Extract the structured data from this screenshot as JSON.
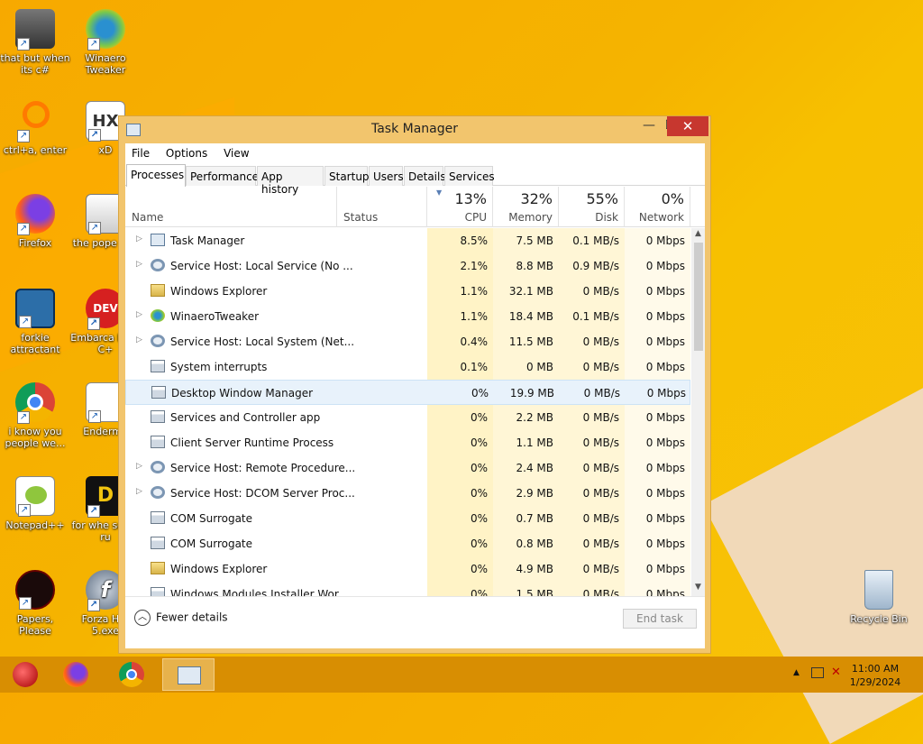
{
  "desktop": {
    "icons": [
      {
        "label": "that but when its c#"
      },
      {
        "label": "Winaero Tweaker"
      },
      {
        "label": "ctrl+a, enter"
      },
      {
        "label": "xD"
      },
      {
        "label": "Firefox"
      },
      {
        "label": "the pope shit"
      },
      {
        "label": "forkie attractant"
      },
      {
        "label": "Embarca Dev-C+"
      },
      {
        "label": "i know you people we..."
      },
      {
        "label": "Enderma"
      },
      {
        "label": "Notepad++"
      },
      {
        "label": "for whe some ru"
      },
      {
        "label": "Papers, Please"
      },
      {
        "label": "Forza Hor 5.exe"
      },
      {
        "label": "Recycle Bin"
      }
    ]
  },
  "window": {
    "title": "Task Manager",
    "min_glyph": "—",
    "max_glyph": "☐",
    "close_glyph": "✕"
  },
  "menu": {
    "file": "File",
    "options": "Options",
    "view": "View"
  },
  "tabs": [
    "Processes",
    "Performance",
    "App history",
    "Startup",
    "Users",
    "Details",
    "Services"
  ],
  "columns": {
    "name": "Name",
    "status": "Status",
    "cpu": {
      "pct": "13%",
      "label": "CPU"
    },
    "memory": {
      "pct": "32%",
      "label": "Memory"
    },
    "disk": {
      "pct": "55%",
      "label": "Disk"
    },
    "network": {
      "pct": "0%",
      "label": "Network"
    }
  },
  "processes": [
    {
      "name": "Task Manager",
      "cpu": "8.5%",
      "mem": "7.5 MB",
      "disk": "0.1 MB/s",
      "net": "0 Mbps"
    },
    {
      "name": "Service Host: Local Service (No ...",
      "cpu": "2.1%",
      "mem": "8.8 MB",
      "disk": "0.9 MB/s",
      "net": "0 Mbps"
    },
    {
      "name": "Windows Explorer",
      "cpu": "1.1%",
      "mem": "32.1 MB",
      "disk": "0 MB/s",
      "net": "0 Mbps"
    },
    {
      "name": "WinaeroTweaker",
      "cpu": "1.1%",
      "mem": "18.4 MB",
      "disk": "0.1 MB/s",
      "net": "0 Mbps"
    },
    {
      "name": "Service Host: Local System (Net...",
      "cpu": "0.4%",
      "mem": "11.5 MB",
      "disk": "0 MB/s",
      "net": "0 Mbps"
    },
    {
      "name": "System interrupts",
      "cpu": "0.1%",
      "mem": "0 MB",
      "disk": "0 MB/s",
      "net": "0 Mbps"
    },
    {
      "name": "Desktop Window Manager",
      "cpu": "0%",
      "mem": "19.9 MB",
      "disk": "0 MB/s",
      "net": "0 Mbps"
    },
    {
      "name": "Services and Controller app",
      "cpu": "0%",
      "mem": "2.2 MB",
      "disk": "0 MB/s",
      "net": "0 Mbps"
    },
    {
      "name": "Client Server Runtime Process",
      "cpu": "0%",
      "mem": "1.1 MB",
      "disk": "0 MB/s",
      "net": "0 Mbps"
    },
    {
      "name": "Service Host: Remote Procedure...",
      "cpu": "0%",
      "mem": "2.4 MB",
      "disk": "0 MB/s",
      "net": "0 Mbps"
    },
    {
      "name": "Service Host: DCOM Server Proc...",
      "cpu": "0%",
      "mem": "2.9 MB",
      "disk": "0 MB/s",
      "net": "0 Mbps"
    },
    {
      "name": "COM Surrogate",
      "cpu": "0%",
      "mem": "0.7 MB",
      "disk": "0 MB/s",
      "net": "0 Mbps"
    },
    {
      "name": "COM Surrogate",
      "cpu": "0%",
      "mem": "0.8 MB",
      "disk": "0 MB/s",
      "net": "0 Mbps"
    },
    {
      "name": "Windows Explorer",
      "cpu": "0%",
      "mem": "4.9 MB",
      "disk": "0 MB/s",
      "net": "0 Mbps"
    },
    {
      "name": "Windows Modules Installer Wor...",
      "cpu": "0%",
      "mem": "1.5 MB",
      "disk": "0 MB/s",
      "net": "0 Mbps"
    }
  ],
  "footer": {
    "fewer": "Fewer details",
    "end_task": "End task"
  },
  "taskbar": {
    "time": "11:00 AM",
    "date": "1/29/2024"
  },
  "colors": {
    "accent_close": "#c7372f",
    "heat_light": "#fff6d6",
    "heat_mid": "#ffeaa8",
    "heat_high": "#ffcc66"
  }
}
